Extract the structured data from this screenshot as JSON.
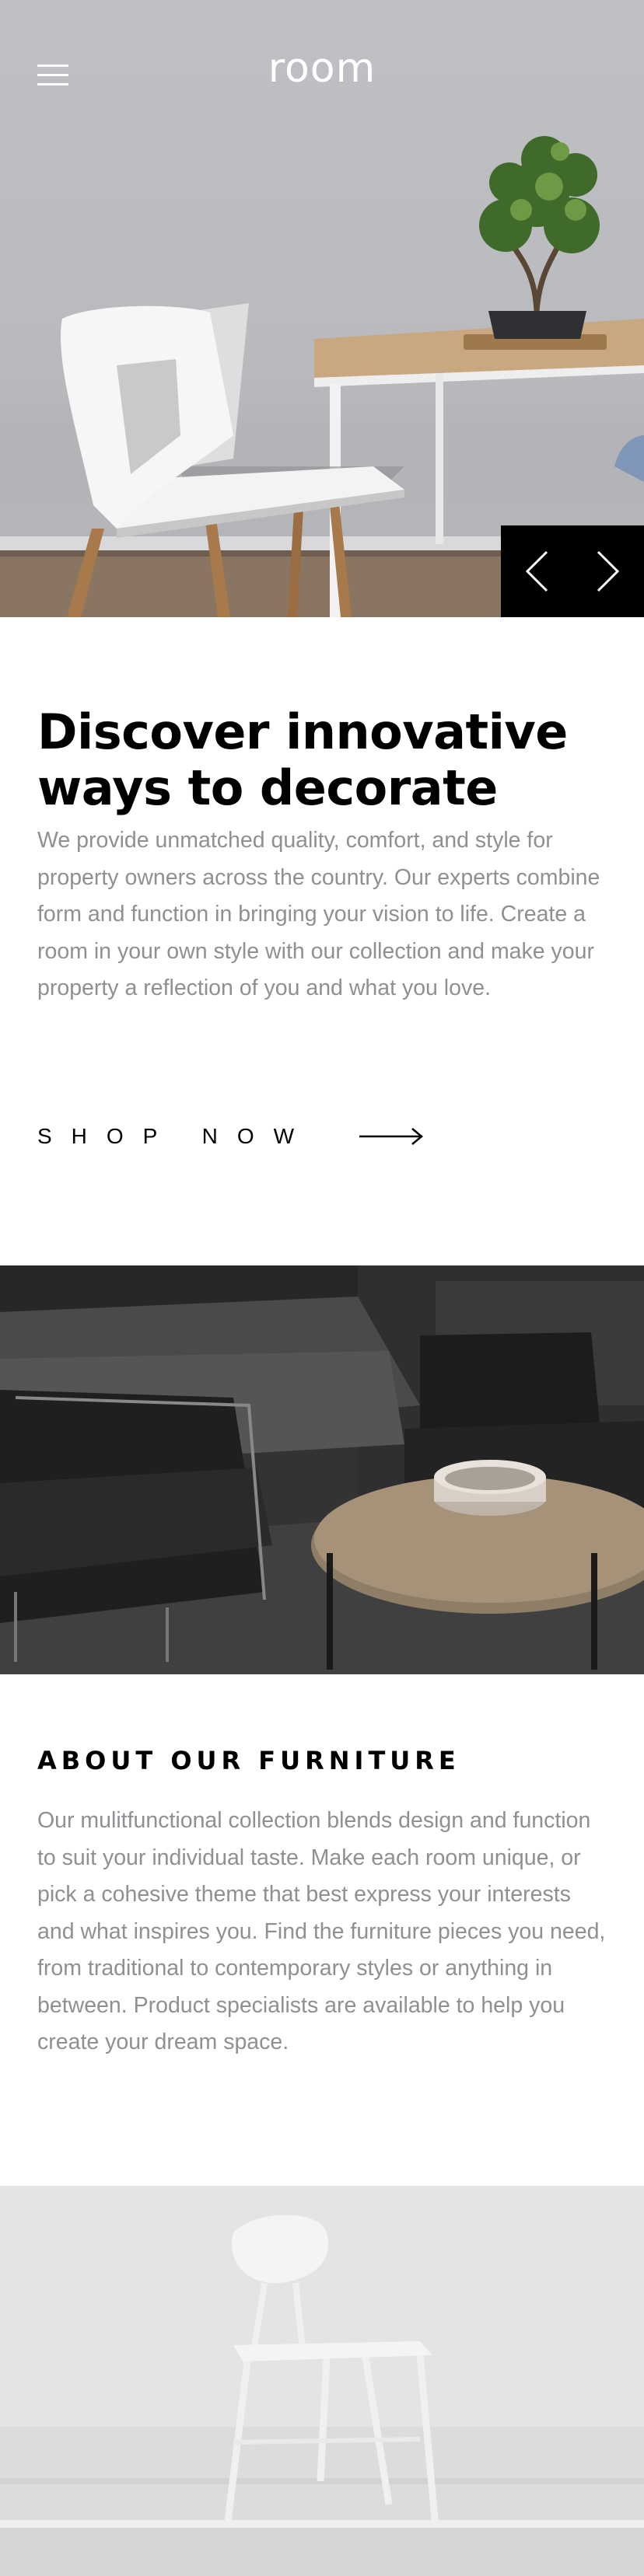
{
  "header": {
    "logo": "room",
    "menu_icon": "hamburger-menu-icon"
  },
  "slider": {
    "prev_icon": "chevron-left-icon",
    "next_icon": "chevron-right-icon"
  },
  "intro": {
    "title": "Discover innovative ways to decorate",
    "body": "We provide unmatched quality, comfort, and style for property owners across the country. Our experts combine form and function in bringing your vision to life. Create a room in your own style with our collection and make your property a reflection of you and what you love."
  },
  "cta": {
    "label": "SHOP NOW",
    "icon": "arrow-right-icon"
  },
  "about": {
    "title": "ABOUT OUR FURNITURE",
    "body": "Our mulitfunctional collection blends design and function to suit your individual taste. Make each room unique, or pick a cohesive theme that best express your interests and what inspires you. Find the furniture pieces you need, from traditional to contemporary styles or anything in between. Product specialists are available to help you create your dream space."
  },
  "colors": {
    "text_primary": "#000000",
    "text_muted": "#8f8f94",
    "control_bg": "#000000"
  }
}
